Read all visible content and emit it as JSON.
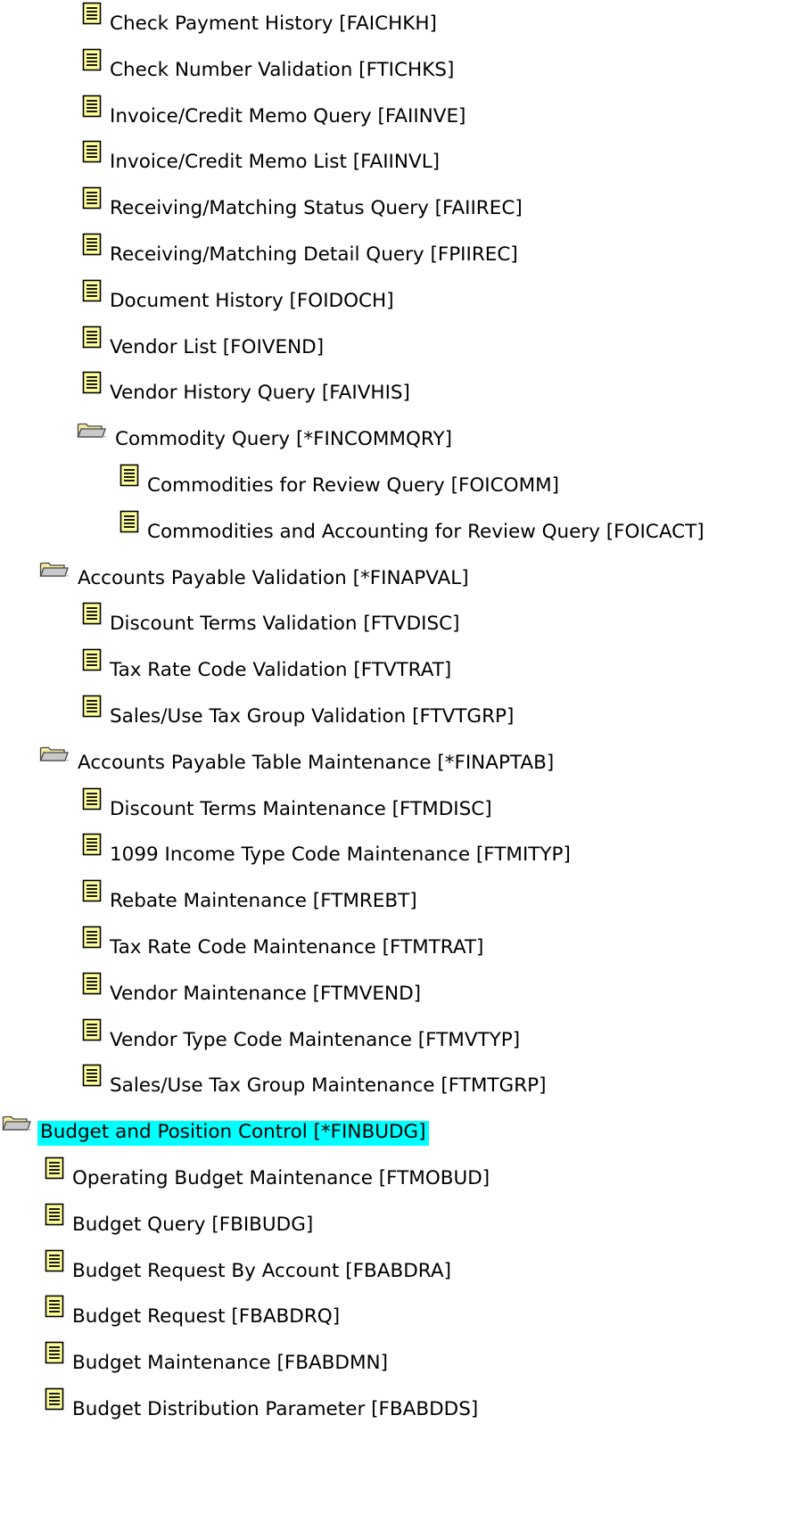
{
  "colors": {
    "highlight": "#00ffff",
    "doc_icon_fill": "#ffff99",
    "folder_icon_fill": "#f6eaa0"
  },
  "items": [
    {
      "label": "Check Payment History [FAICHKH]",
      "type": "document",
      "level": 2
    },
    {
      "label": "Check Number Validation [FTICHKS]",
      "type": "document",
      "level": 2
    },
    {
      "label": "Invoice/Credit Memo Query [FAIINVE]",
      "type": "document",
      "level": 2
    },
    {
      "label": "Invoice/Credit Memo List [FAIINVL]",
      "type": "document",
      "level": 2
    },
    {
      "label": "Receiving/Matching Status Query [FAIIREC]",
      "type": "document",
      "level": 2
    },
    {
      "label": "Receiving/Matching Detail Query [FPIIREC]",
      "type": "document",
      "level": 2
    },
    {
      "label": "Document History [FOIDOCH]",
      "type": "document",
      "level": 2
    },
    {
      "label": "Vendor List [FOIVEND]",
      "type": "document",
      "level": 2
    },
    {
      "label": "Vendor History Query [FAIVHIS]",
      "type": "document",
      "level": 2
    },
    {
      "label": "Commodity Query [*FINCOMMQRY]",
      "type": "folder",
      "level": 2
    },
    {
      "label": "Commodities for Review Query [FOICOMM]",
      "type": "document",
      "level": 3
    },
    {
      "label": "Commodities and Accounting for Review Query [FOICACT]",
      "type": "document",
      "level": 3
    },
    {
      "label": "Accounts Payable Validation [*FINAPVAL]",
      "type": "folder",
      "level": 1
    },
    {
      "label": "Discount Terms Validation [FTVDISC]",
      "type": "document",
      "level": 2
    },
    {
      "label": "Tax Rate Code Validation [FTVTRAT]",
      "type": "document",
      "level": 2
    },
    {
      "label": "Sales/Use Tax Group Validation [FTVTGRP]",
      "type": "document",
      "level": 2
    },
    {
      "label": "Accounts Payable Table Maintenance [*FINAPTAB]",
      "type": "folder",
      "level": 1
    },
    {
      "label": "Discount Terms Maintenance [FTMDISC]",
      "type": "document",
      "level": 2
    },
    {
      "label": "1099 Income Type Code Maintenance [FTMITYP]",
      "type": "document",
      "level": 2
    },
    {
      "label": "Rebate Maintenance [FTMREBT]",
      "type": "document",
      "level": 2
    },
    {
      "label": "Tax Rate Code Maintenance [FTMTRAT]",
      "type": "document",
      "level": 2
    },
    {
      "label": "Vendor Maintenance [FTMVEND]",
      "type": "document",
      "level": 2
    },
    {
      "label": "Vendor Type Code Maintenance [FTMVTYP]",
      "type": "document",
      "level": 2
    },
    {
      "label": "Sales/Use Tax Group Maintenance [FTMTGRP]",
      "type": "document",
      "level": 2
    },
    {
      "label": "Budget and Position Control [*FINBUDG]",
      "type": "folder",
      "level": 0,
      "highlighted": true
    },
    {
      "label": "Operating Budget Maintenance [FTMOBUD]",
      "type": "document",
      "level": 1
    },
    {
      "label": "Budget Query [FBIBUDG]",
      "type": "document",
      "level": 1
    },
    {
      "label": "Budget Request By Account [FBABDRA]",
      "type": "document",
      "level": 1
    },
    {
      "label": "Budget Request [FBABDRQ]",
      "type": "document",
      "level": 1
    },
    {
      "label": "Budget Maintenance [FBABDMN]",
      "type": "document",
      "level": 1
    },
    {
      "label": "Budget Distribution Parameter [FBABDDS]",
      "type": "document",
      "level": 1
    }
  ]
}
